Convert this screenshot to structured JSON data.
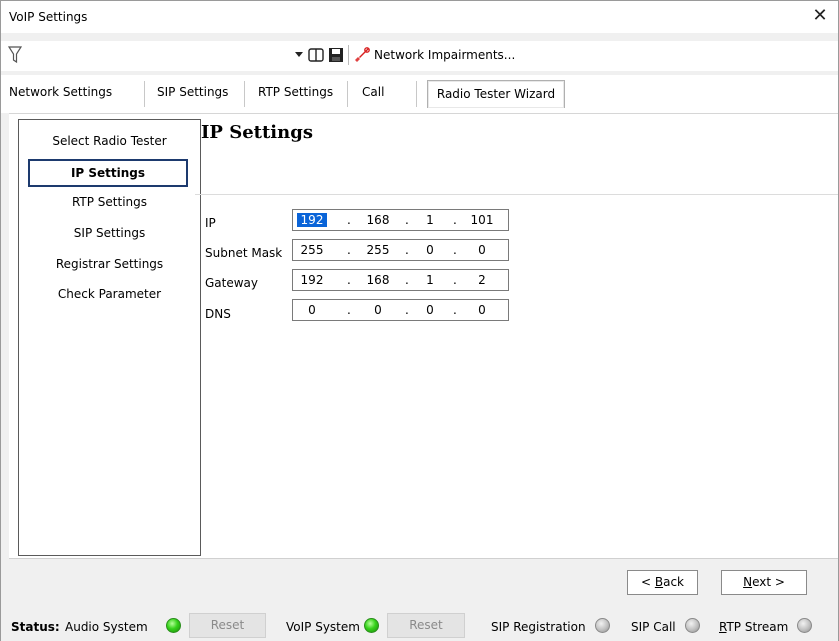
{
  "window": {
    "title": "VoIP Settings"
  },
  "toolbar": {
    "filter_value": "",
    "network_impairments_label": "Network Impairments..."
  },
  "tabs": [
    {
      "label": "Network Settings"
    },
    {
      "label": "SIP Settings"
    },
    {
      "label": "RTP Settings"
    },
    {
      "label": "Call"
    },
    {
      "label": "Radio Tester Wizard",
      "active": true
    }
  ],
  "wizard": {
    "steps": [
      {
        "label": "Select Radio Tester"
      },
      {
        "label": "IP Settings",
        "selected": true
      },
      {
        "label": "RTP Settings"
      },
      {
        "label": "SIP Settings"
      },
      {
        "label": "Registrar Settings"
      },
      {
        "label": "Check Parameter"
      }
    ],
    "panel_title": "IP Settings",
    "fields": [
      {
        "label": "IP",
        "octets": [
          "192",
          "168",
          "1",
          "101"
        ],
        "highlighted_octet": 0
      },
      {
        "label": "Subnet Mask",
        "octets": [
          "255",
          "255",
          "0",
          "0"
        ]
      },
      {
        "label": "Gateway",
        "octets": [
          "192",
          "168",
          "1",
          "2"
        ]
      },
      {
        "label": "DNS",
        "octets": [
          "0",
          "0",
          "0",
          "0"
        ]
      }
    ],
    "separator": "."
  },
  "navigation": {
    "back_label": "Back",
    "back_prefix": "< ",
    "back_mnemonic": "B",
    "back_rest": "ack",
    "next_label": "Next >",
    "next_mnemonic": "N",
    "next_rest": "ext >"
  },
  "status": {
    "label": "Status:",
    "audio_system": {
      "label": "Audio System",
      "state": "green"
    },
    "reset_label": "Reset",
    "voip_system": {
      "label": "VoIP System",
      "state": "green"
    },
    "sip_registration": {
      "label": "SIP Registration",
      "state": "gray"
    },
    "sip_call": {
      "label": "SIP Call",
      "state": "gray"
    },
    "rtp_stream": {
      "label": "RTP Stream",
      "state": "gray",
      "mnemonic": "R",
      "rest": "TP Stream"
    }
  },
  "colors": {
    "selection_blue": "#0a64d8",
    "led_green": "#36d21b",
    "led_gray": "#c0c0c0",
    "selected_step_border": "#1d3a6e"
  }
}
